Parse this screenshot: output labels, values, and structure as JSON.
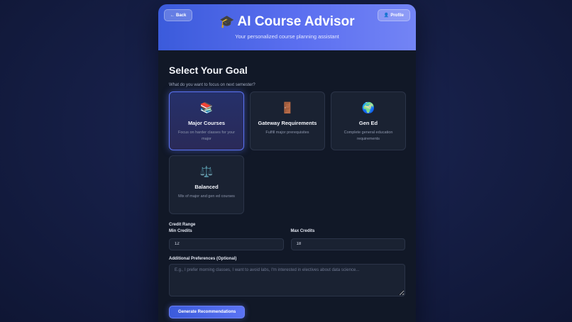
{
  "header": {
    "back_label": "Back",
    "back_icon": "←",
    "profile_label": "Profile",
    "profile_icon": "👤",
    "title_icon": "🎓",
    "title": "AI Course Advisor",
    "subtitle": "Your personalized course planning assistant"
  },
  "goal": {
    "title": "Select Your Goal",
    "question": "What do you want to focus on next semester?",
    "options": [
      {
        "icon": "📚",
        "label": "Major Courses",
        "desc": "Focus on harder classes for your major",
        "selected": true
      },
      {
        "icon": "🚪",
        "label": "Gateway Requirements",
        "desc": "Fulfill major prerequisites",
        "selected": false
      },
      {
        "icon": "🌍",
        "label": "Gen Ed",
        "desc": "Complete general education requirements",
        "selected": false
      },
      {
        "icon": "⚖️",
        "label": "Balanced",
        "desc": "Mix of major and gen ed courses",
        "selected": false
      }
    ]
  },
  "credits": {
    "section_label": "Credit Range",
    "min_label": "Min Credits",
    "min_value": "12",
    "max_label": "Max Credits",
    "max_value": "18"
  },
  "preferences": {
    "label": "Additional Preferences (Optional)",
    "placeholder": "E.g., I prefer morning classes, I want to avoid labs, I'm interested in electives about data science..."
  },
  "actions": {
    "generate_label": "Generate Recommendations"
  },
  "colors": {
    "accent": "#5b73f4",
    "header_start": "#3b5bdb",
    "card_bg": "#111827"
  }
}
